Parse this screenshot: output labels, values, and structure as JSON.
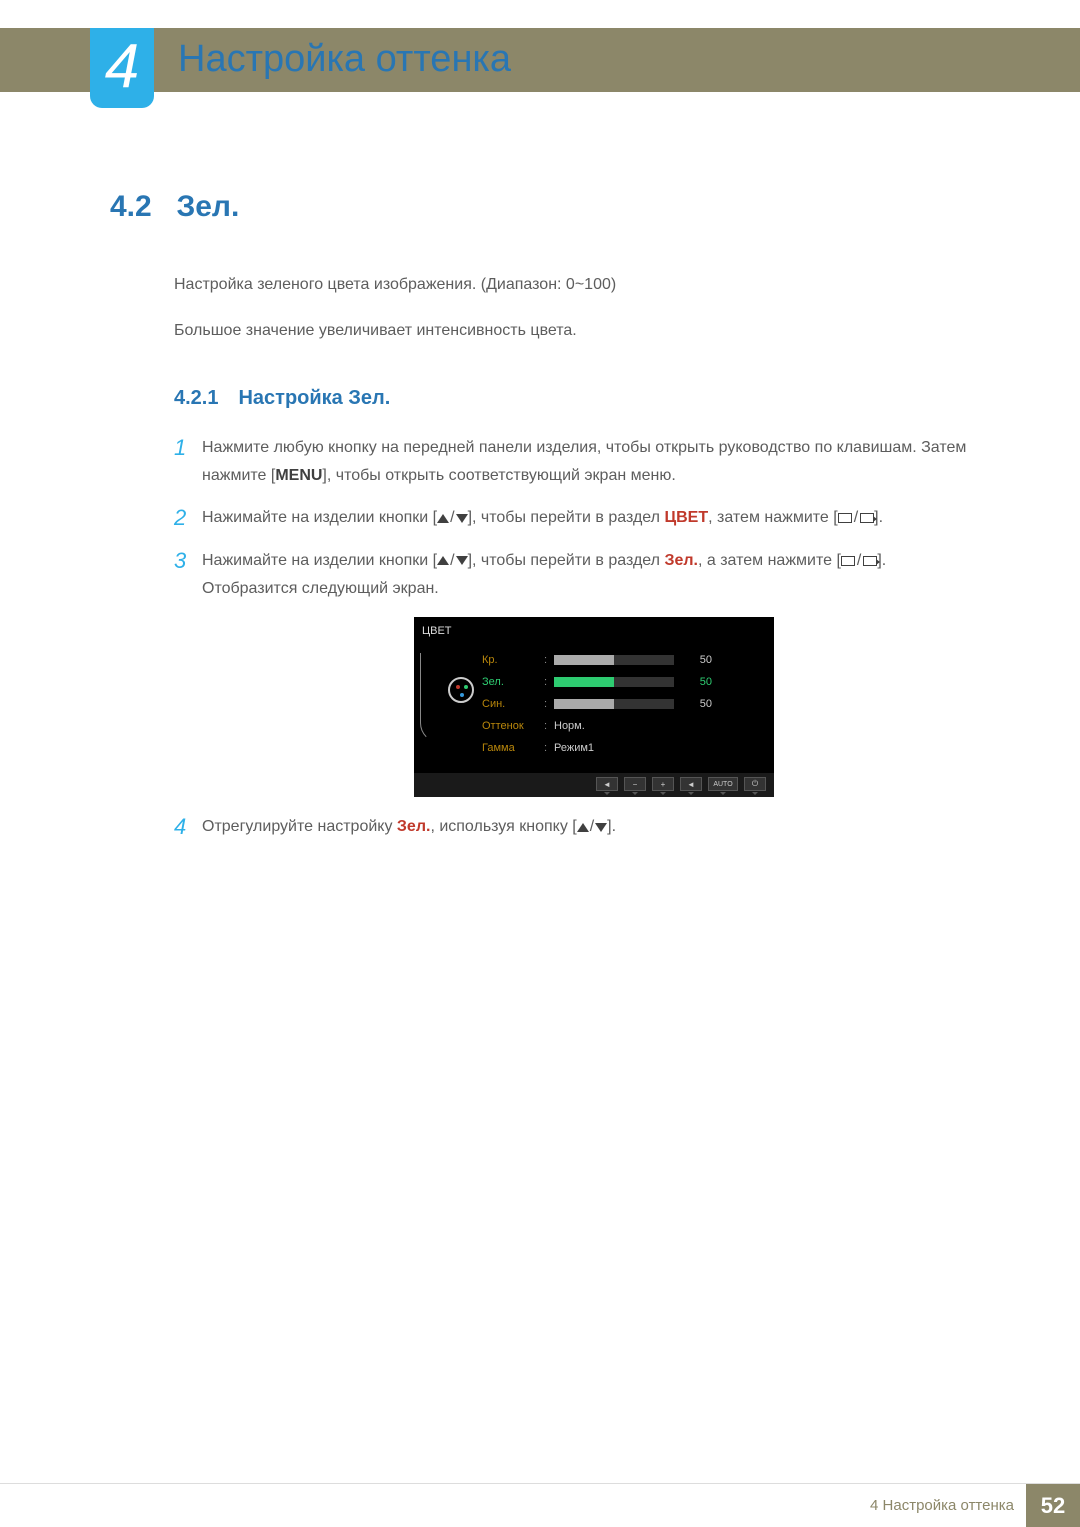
{
  "chapter": {
    "number": "4",
    "title": "Настройка оттенка"
  },
  "section": {
    "number": "4.2",
    "title": "Зел."
  },
  "intro": {
    "p1": "Настройка зеленого цвета изображения. (Диапазон: 0~100)",
    "p2": "Большое значение увеличивает интенсивность цвета."
  },
  "subsection": {
    "number": "4.2.1",
    "title": "Настройка Зел."
  },
  "steps": {
    "s1": {
      "n": "1",
      "t1": "Нажмите любую кнопку на передней панели изделия, чтобы открыть руководство по клавишам. Затем нажмите [",
      "menu": "MENU",
      "t2": "], чтобы открыть соответствующий экран меню."
    },
    "s2": {
      "n": "2",
      "t1": "Нажимайте на изделии кнопки [",
      "t2": "], чтобы перейти в раздел ",
      "hl": "ЦВЕТ",
      "t3": ", затем нажмите [",
      "t4": "]."
    },
    "s3": {
      "n": "3",
      "t1": "Нажимайте на изделии кнопки [",
      "t2": "], чтобы перейти в раздел ",
      "hl": "Зел.",
      "t3": ", а затем нажмите [",
      "t4": "]. Отобразится следующий экран."
    },
    "s4": {
      "n": "4",
      "t1": "Отрегулируйте настройку ",
      "hl": "Зел.",
      "t2": ", используя кнопку [",
      "t3": "]."
    }
  },
  "osd": {
    "title": "ЦВЕТ",
    "rows": [
      {
        "label": "Кр.",
        "value": "50",
        "fill": 50,
        "selected": false,
        "type": "bar"
      },
      {
        "label": "Зел.",
        "value": "50",
        "fill": 50,
        "selected": true,
        "type": "bar"
      },
      {
        "label": "Син.",
        "value": "50",
        "fill": 50,
        "selected": false,
        "type": "bar"
      },
      {
        "label": "Оттенок",
        "text": "Норм.",
        "type": "text"
      },
      {
        "label": "Гамма",
        "text": "Режим1",
        "type": "text"
      }
    ],
    "buttons": [
      "◄",
      "−",
      "+",
      "◄",
      "AUTO",
      "⏻"
    ]
  },
  "footer": {
    "label": "4 Настройка оттенка",
    "page": "52"
  }
}
